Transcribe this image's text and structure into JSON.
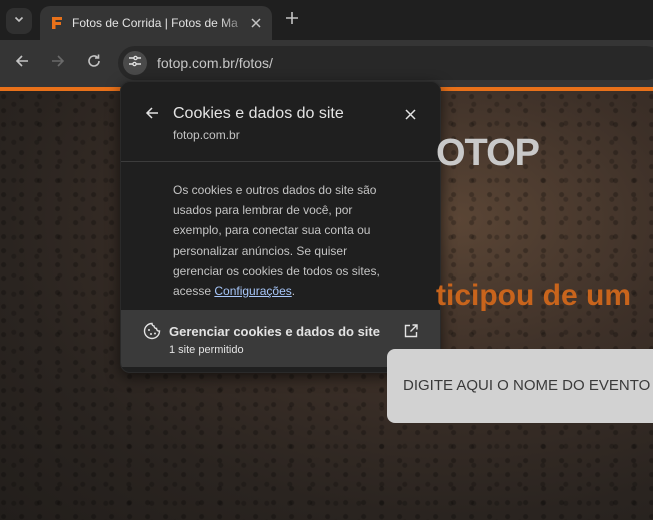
{
  "browser": {
    "tab": {
      "title": "Fotos de Corrida | Fotos de Ma",
      "favicon": "fotop-f-icon"
    },
    "url": "fotop.com.br/fotos/"
  },
  "page": {
    "logo_text": "OTOP",
    "headline": "ticipou de um",
    "search_placeholder": "DIGITE AQUI O NOME DO EVENTO",
    "colors": {
      "accent": "#e8711a",
      "headline": "#c8641c"
    }
  },
  "popup": {
    "title": "Cookies e dados do site",
    "domain": "fotop.com.br",
    "description_before_link": "Os cookies e outros dados do site são usados para lembrar de você, por exemplo, para conectar sua conta ou personalizar anúncios. Se quiser gerenciar os cookies de todos os sites, acesse ",
    "settings_link": "Configurações",
    "description_after_link": ".",
    "manage": {
      "title": "Gerenciar cookies e dados do site",
      "subtitle": "1 site permitido"
    }
  }
}
